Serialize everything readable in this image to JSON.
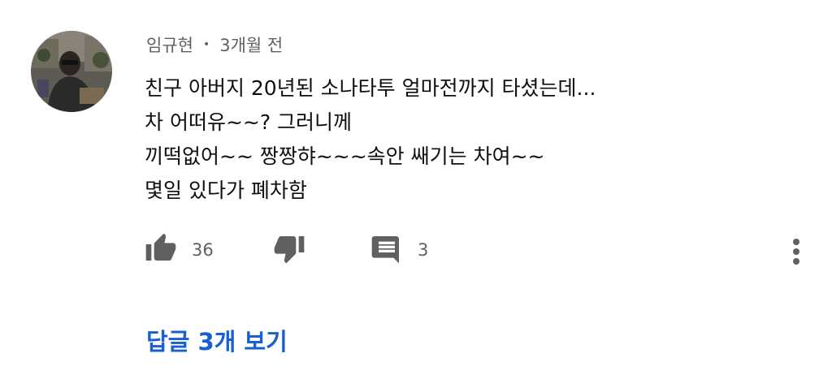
{
  "comment": {
    "author": "임규현",
    "separator": "•",
    "time": "3개월 전",
    "lines": [
      "친구 아버지 20년된 소나타투 얼마전까지 타셨는데...",
      "차 어떠유~~? 그러니께",
      "끼떡없어~~ 짱짱햐~~~속안 쌔기는 차여~~",
      "몇일 있다가 폐차함"
    ],
    "like_count": "36",
    "reply_count": "3",
    "view_replies_label": "답글 3개 보기"
  },
  "icons": {
    "like": "thumbs-up-icon",
    "dislike": "thumbs-down-icon",
    "reply": "comment-icon",
    "menu": "more-vert-icon"
  },
  "colors": {
    "text": "#0f0f0f",
    "secondary": "#606060",
    "icon": "#606060",
    "link": "#1a5fd2"
  }
}
